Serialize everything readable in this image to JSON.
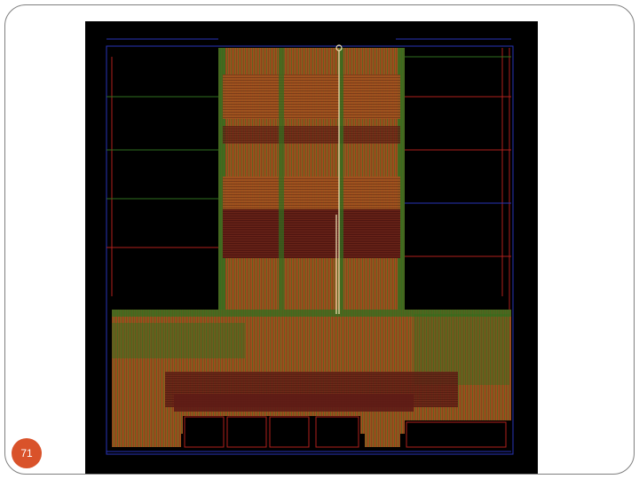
{
  "slide": {
    "number": "71"
  },
  "layout_image": {
    "description_colors": {
      "background": "#000000",
      "cell_fill": "#a0521e",
      "dense_routing": "#5e1c16",
      "green_routing": "#2f6f1f",
      "red_wire": "#b0201c",
      "blue_wire": "#2733b8",
      "highlight_net": "#f4e7b8"
    }
  }
}
